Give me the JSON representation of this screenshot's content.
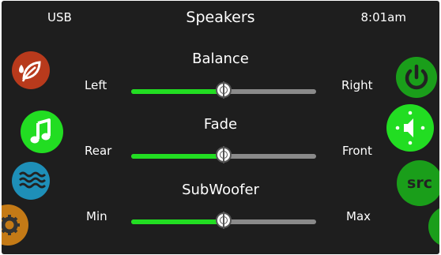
{
  "header": {
    "source": "USB",
    "title": "Speakers",
    "time": "8:01am"
  },
  "left_nav": [
    {
      "name": "light-mode",
      "icon": "leaf-drop-icon",
      "color": "#b83a1c"
    },
    {
      "name": "music",
      "icon": "music-note-icon",
      "color": "#22dd22"
    },
    {
      "name": "water",
      "icon": "waves-icon",
      "color": "#1e8fb8"
    },
    {
      "name": "settings",
      "icon": "gear-icon",
      "color": "#c47a16"
    }
  ],
  "right_nav": [
    {
      "name": "power",
      "icon": "power-icon",
      "color": "#1a9e1a"
    },
    {
      "name": "speakers",
      "icon": "speaker-icon",
      "color": "#22dd22"
    },
    {
      "name": "source",
      "icon": "src-icon",
      "label": "src",
      "color": "#1a9e1a"
    },
    {
      "name": "extra",
      "icon": "circle-icon",
      "color": "#1a9e1a"
    }
  ],
  "sliders": [
    {
      "id": "balance",
      "title": "Balance",
      "left_label": "Left",
      "right_label": "Right",
      "value": 0.5
    },
    {
      "id": "fade",
      "title": "Fade",
      "left_label": "Rear",
      "right_label": "Front",
      "value": 0.5
    },
    {
      "id": "subwoofer",
      "title": "SubWoofer",
      "left_label": "Min",
      "right_label": "Max",
      "value": 0.5
    }
  ]
}
